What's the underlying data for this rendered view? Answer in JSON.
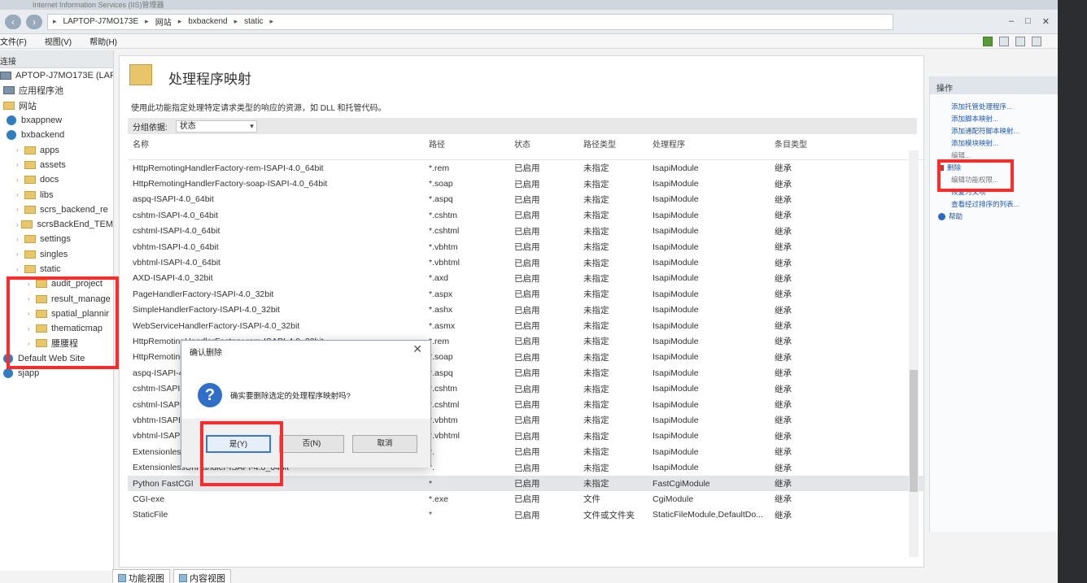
{
  "window": {
    "title": "Internet Information Services (IIS)管理器",
    "address": [
      "LAPTOP-J7MO173E",
      "网站",
      "bxbackend",
      "static"
    ]
  },
  "menu": [
    "文件(F)",
    "视图(V)",
    "帮助(H)"
  ],
  "left": {
    "header": "连接",
    "tree": [
      {
        "label": "APTOP-J7MO173E (LAPTO",
        "kind": "server",
        "indent": 0
      },
      {
        "label": "应用程序池",
        "kind": "pool",
        "indent": 4
      },
      {
        "label": "网站",
        "kind": "folder",
        "indent": 4
      },
      {
        "label": "bxappnew",
        "kind": "globe",
        "indent": 8
      },
      {
        "label": "bxbackend",
        "kind": "globe",
        "indent": 8
      },
      {
        "label": "apps",
        "kind": "folder",
        "indent": 20
      },
      {
        "label": "assets",
        "kind": "folder",
        "indent": 20
      },
      {
        "label": "docs",
        "kind": "folder",
        "indent": 20
      },
      {
        "label": "libs",
        "kind": "folder",
        "indent": 20
      },
      {
        "label": "scrs_backend_re",
        "kind": "folder",
        "indent": 20
      },
      {
        "label": "scrsBackEnd_TEM",
        "kind": "folder",
        "indent": 20
      },
      {
        "label": "settings",
        "kind": "folder",
        "indent": 20
      },
      {
        "label": "singles",
        "kind": "folder",
        "indent": 20
      },
      {
        "label": "static",
        "kind": "folder",
        "indent": 20
      },
      {
        "label": "audit_project",
        "kind": "folder",
        "indent": 34
      },
      {
        "label": "result_manage",
        "kind": "folder",
        "indent": 34
      },
      {
        "label": "spatial_plannir",
        "kind": "folder",
        "indent": 34
      },
      {
        "label": "thematicmap",
        "kind": "folder",
        "indent": 34
      },
      {
        "label": "腰腰程",
        "kind": "folder",
        "indent": 34
      },
      {
        "label": "Default Web Site",
        "kind": "globe",
        "indent": 4
      },
      {
        "label": "sjapp",
        "kind": "globe",
        "indent": 4
      }
    ]
  },
  "feature": {
    "title": "处理程序映射",
    "description": "使用此功能指定处理特定请求类型的响应的资源，如 DLL 和托管代码。",
    "group_label": "分组依据:",
    "group_value": "状态",
    "columns": [
      "名称",
      "路径",
      "状态",
      "路径类型",
      "处理程序",
      "条目类型"
    ],
    "rows": [
      [
        "HttpRemotingHandlerFactory-rem-ISAPI-4.0_64bit",
        "*.rem",
        "已启用",
        "未指定",
        "IsapiModule",
        "继承"
      ],
      [
        "HttpRemotingHandlerFactory-soap-ISAPI-4.0_64bit",
        "*.soap",
        "已启用",
        "未指定",
        "IsapiModule",
        "继承"
      ],
      [
        "aspq-ISAPI-4.0_64bit",
        "*.aspq",
        "已启用",
        "未指定",
        "IsapiModule",
        "继承"
      ],
      [
        "cshtm-ISAPI-4.0_64bit",
        "*.cshtm",
        "已启用",
        "未指定",
        "IsapiModule",
        "继承"
      ],
      [
        "cshtml-ISAPI-4.0_64bit",
        "*.cshtml",
        "已启用",
        "未指定",
        "IsapiModule",
        "继承"
      ],
      [
        "vbhtm-ISAPI-4.0_64bit",
        "*.vbhtm",
        "已启用",
        "未指定",
        "IsapiModule",
        "继承"
      ],
      [
        "vbhtml-ISAPI-4.0_64bit",
        "*.vbhtml",
        "已启用",
        "未指定",
        "IsapiModule",
        "继承"
      ],
      [
        "AXD-ISAPI-4.0_32bit",
        "*.axd",
        "已启用",
        "未指定",
        "IsapiModule",
        "继承"
      ],
      [
        "PageHandlerFactory-ISAPI-4.0_32bit",
        "*.aspx",
        "已启用",
        "未指定",
        "IsapiModule",
        "继承"
      ],
      [
        "SimpleHandlerFactory-ISAPI-4.0_32bit",
        "*.ashx",
        "已启用",
        "未指定",
        "IsapiModule",
        "继承"
      ],
      [
        "WebServiceHandlerFactory-ISAPI-4.0_32bit",
        "*.asmx",
        "已启用",
        "未指定",
        "IsapiModule",
        "继承"
      ],
      [
        "HttpRemotingHandlerFactory-rem-ISAPI-4.0_32bit",
        "*.rem",
        "已启用",
        "未指定",
        "IsapiModule",
        "继承"
      ],
      [
        "HttpRemotingHandlerFactory-soap-ISAPI-4.0_32bit",
        "*.soap",
        "已启用",
        "未指定",
        "IsapiModule",
        "继承"
      ],
      [
        "aspq-ISAPI-4.0_32bit",
        "*.aspq",
        "已启用",
        "未指定",
        "IsapiModule",
        "继承"
      ],
      [
        "cshtm-ISAPI-4.0_32bit",
        "*.cshtm",
        "已启用",
        "未指定",
        "IsapiModule",
        "继承"
      ],
      [
        "cshtml-ISAPI-4.0_32bit",
        "*.cshtml",
        "已启用",
        "未指定",
        "IsapiModule",
        "继承"
      ],
      [
        "vbhtm-ISAPI-4.0_32bit",
        "*.vbhtm",
        "已启用",
        "未指定",
        "IsapiModule",
        "继承"
      ],
      [
        "vbhtml-ISAPI-4.0_32bit",
        "*.vbhtml",
        "已启用",
        "未指定",
        "IsapiModule",
        "继承"
      ],
      [
        "ExtensionlessUrlHandler-ISAPI-4.0_32bit",
        "*.",
        "已启用",
        "未指定",
        "IsapiModule",
        "继承"
      ],
      [
        "ExtensionlessUrlHandler-ISAPI-4.0_64bit",
        "*.",
        "已启用",
        "未指定",
        "IsapiModule",
        "继承"
      ],
      [
        "Python FastCGI",
        "*",
        "已启用",
        "未指定",
        "FastCgiModule",
        "继承"
      ],
      [
        "CGI-exe",
        "*.exe",
        "已启用",
        "文件",
        "CgiModule",
        "继承"
      ],
      [
        "StaticFile",
        "*",
        "已启用",
        "文件或文件夹",
        "StaticFileModule,DefaultDo...",
        "继承"
      ]
    ]
  },
  "actions": {
    "header": "操作",
    "items": [
      "添加托管处理程序...",
      "添加脚本映射...",
      "添加通配符脚本映射...",
      "添加模块映射...",
      "编辑...",
      "删除",
      "编辑功能权限...",
      "恢复为父项",
      "查看经过排序的列表...",
      "帮助"
    ]
  },
  "dialog": {
    "title": "确认删除",
    "message": "确实要删除选定的处理程序映射吗?",
    "yes": "是(Y)",
    "no": "否(N)",
    "cancel": "取消"
  },
  "view_tabs": [
    "功能视图",
    "内容视图"
  ],
  "colors": {
    "annotation": "#ff2a2a",
    "link": "#1b58b0"
  }
}
